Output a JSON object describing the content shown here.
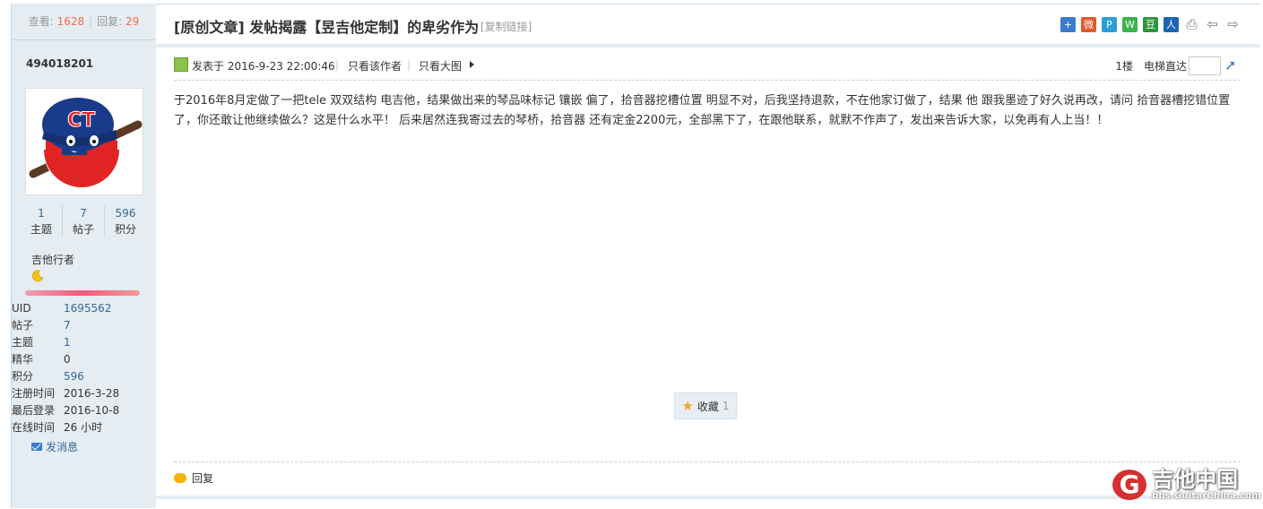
{
  "sidebar": {
    "views_label": "查看:",
    "views": "1628",
    "replies_label": "回复:",
    "replies": "29",
    "username": "494018201",
    "stats": [
      {
        "value": "1",
        "label": "主题"
      },
      {
        "value": "7",
        "label": "帖子"
      },
      {
        "value": "596",
        "label": "积分"
      }
    ],
    "usergroup": "吉他行者",
    "profile": [
      {
        "key": "UID",
        "value": "1695562",
        "link": true
      },
      {
        "key": "帖子",
        "value": "7",
        "link": true
      },
      {
        "key": "主题",
        "value": "1",
        "link": true
      },
      {
        "key": "精华",
        "value": "0",
        "link": false
      },
      {
        "key": "积分",
        "value": "596",
        "link": true
      },
      {
        "key": "注册时间",
        "value": "2016-3-28",
        "link": false
      },
      {
        "key": "最后登录",
        "value": "2016-10-8",
        "link": false
      },
      {
        "key": "在线时间",
        "value": "26 小时",
        "link": false
      }
    ],
    "send_message": "发消息"
  },
  "thread": {
    "title": "[原创文章] 发帖揭露【昱吉他定制】的卑劣作为",
    "copy_link": "[复制链接]",
    "share_icons": [
      {
        "name": "qzone-share-icon",
        "glyph": "+",
        "color": "#3a7ccb"
      },
      {
        "name": "weibo-share-icon",
        "glyph": "微",
        "color": "#e05a2a"
      },
      {
        "name": "tencent-weibo-share-icon",
        "glyph": "P",
        "color": "#2a9fd6"
      },
      {
        "name": "wechat-share-icon",
        "glyph": "W",
        "color": "#3bb34a"
      },
      {
        "name": "douban-share-icon",
        "glyph": "豆",
        "color": "#2e963d"
      },
      {
        "name": "renren-share-icon",
        "glyph": "人",
        "color": "#1a66b3"
      },
      {
        "name": "print-icon",
        "glyph": "⎙",
        "color": "#ffffff"
      },
      {
        "name": "prev-thread-icon",
        "glyph": "⇦",
        "color": "#ffffff"
      },
      {
        "name": "next-thread-icon",
        "glyph": "⇨",
        "color": "#ffffff"
      }
    ]
  },
  "post": {
    "posted_at": "发表于 2016-9-23 22:00:46",
    "only_author": "只看该作者",
    "view_large": "只看大图",
    "floor": "1楼",
    "elevator": "电梯直达",
    "content": "于2016年8月定做了一把tele 双双结构 电吉他，结果做出来的琴品味标记 镶嵌 偏了，拾音器挖槽位置 明显不对，后我坚持退款，不在他家订做了，结果 他 跟我墨迹了好久说再改，请问 拾音器槽挖错位置了，你还敢让他继续做么？这是什么水平！ 后来居然连我寄过去的琴桥，拾音器 还有定金2200元，全部黑下了，在跟他联系，就默不作声了，发出来告诉大家，以免再有人上当！！",
    "favorite_label": "收藏",
    "favorite_count": "1",
    "reply_label": "回复"
  },
  "watermark": {
    "logo": "G",
    "name": "吉他中国",
    "url": "bbs.GuitarChina.com"
  }
}
